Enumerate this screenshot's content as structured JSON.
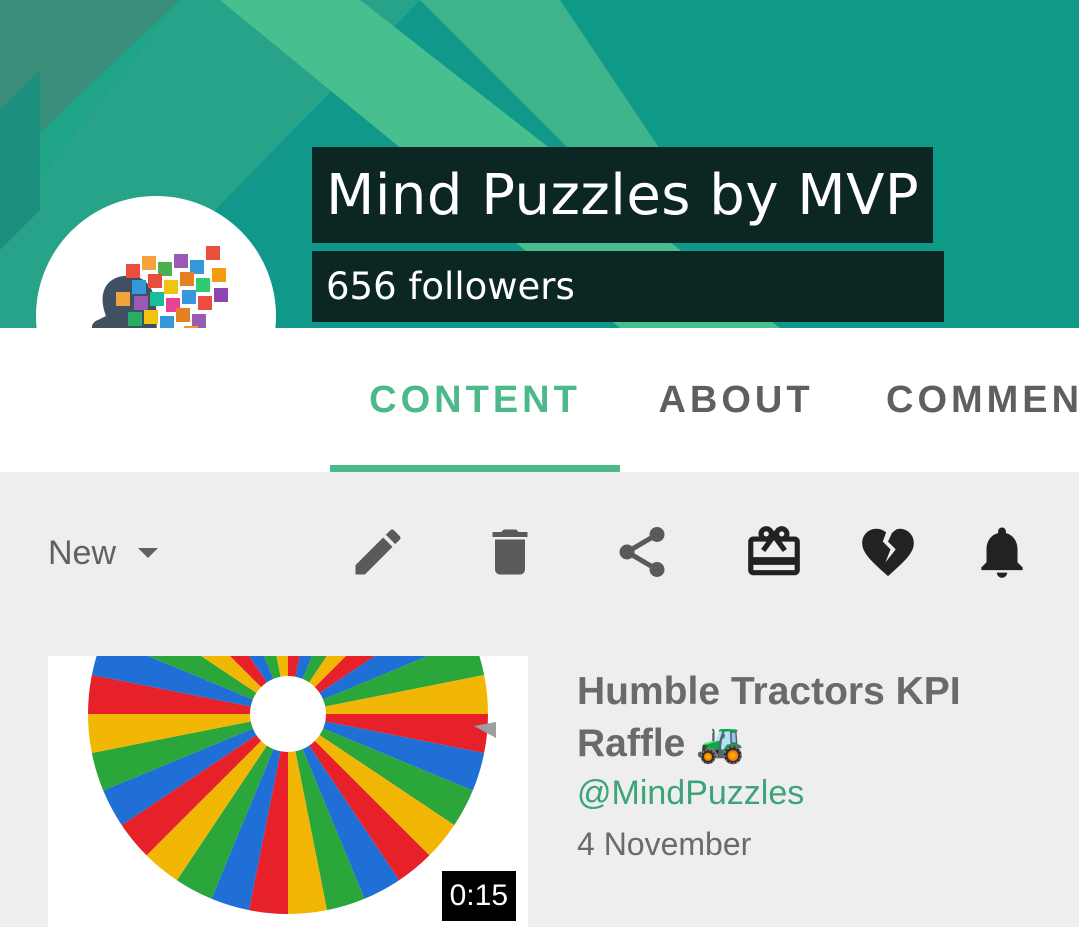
{
  "channel": {
    "name": "Mind Puzzles by MVP",
    "followers": "656 followers"
  },
  "tabs": [
    {
      "label": "CONTENT",
      "active": true
    },
    {
      "label": "ABOUT",
      "active": false
    },
    {
      "label": "COMMEN",
      "active": false
    }
  ],
  "toolbar": {
    "sort_label": "New",
    "icons": [
      "edit-icon",
      "trash-icon",
      "share-icon",
      "gift-icon",
      "broken-heart-icon",
      "bell-icon"
    ]
  },
  "videos": [
    {
      "title": "Humble Tractors KPI Raffle 🚜",
      "channel_handle": "@MindPuzzles",
      "date": "4 November",
      "duration": "0:15"
    }
  ],
  "colors": {
    "accent": "#4cb989",
    "banner": "#15a08d",
    "title_bg": "#0c2623"
  }
}
